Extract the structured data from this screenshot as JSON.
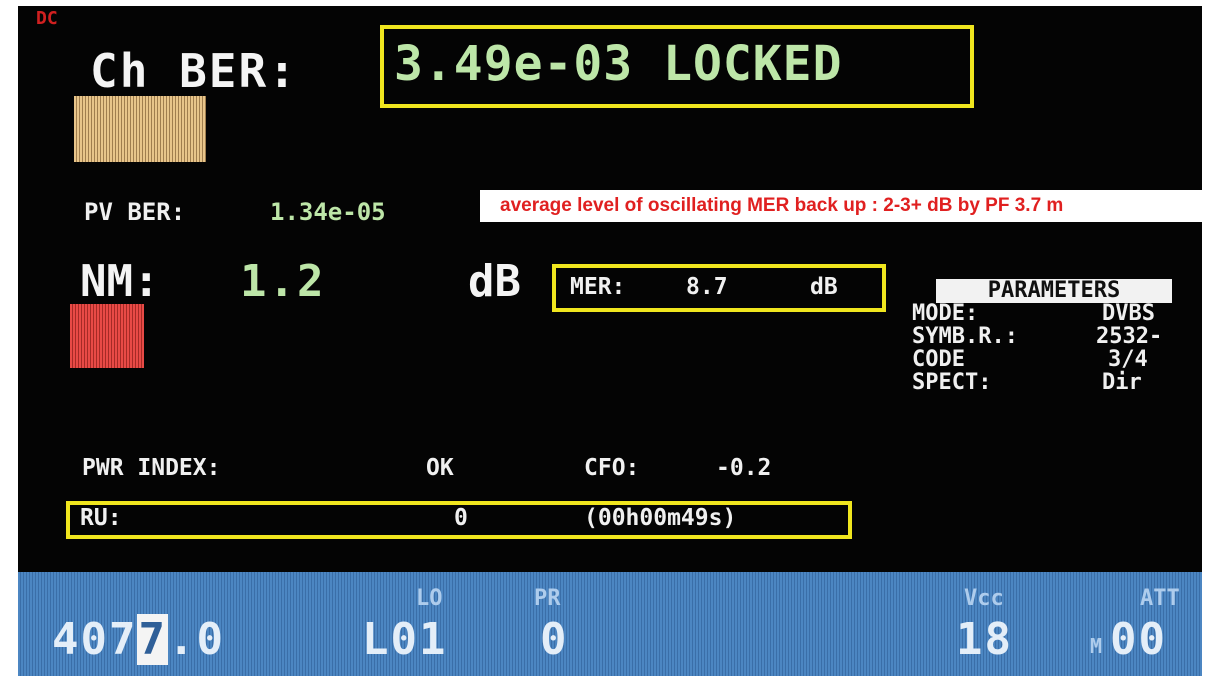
{
  "header": {
    "mode_tag": "DC"
  },
  "ch_ber": {
    "label": "Ch BER:",
    "value": "3.49e-03 LOCKED"
  },
  "pv_ber": {
    "label": "PV BER:",
    "value": "1.34e-05"
  },
  "annotation": {
    "text": "average level of oscillating MER back up : 2-3+ dB by PF 3.7 m"
  },
  "nm": {
    "label": "NM:",
    "value": "1.2",
    "unit": "dB"
  },
  "mer": {
    "label": "MER:",
    "value": "8.7",
    "unit": "dB"
  },
  "parameters": {
    "title": "PARAMETERS",
    "rows": [
      {
        "key": "MODE:",
        "value": "DVBS"
      },
      {
        "key": "SYMB.R.:",
        "value": "2532-"
      },
      {
        "key": "CODE",
        "value": "3/4"
      },
      {
        "key": "SPECT:",
        "value": "Dir"
      }
    ]
  },
  "pwr_index": {
    "label": "PWR INDEX:",
    "value": "OK"
  },
  "cfo": {
    "label": "CFO:",
    "value": "-0.2"
  },
  "ru": {
    "label": "RU:",
    "value": "0",
    "time": "(00h00m49s)"
  },
  "status_bar": {
    "freq_prefix": "407",
    "freq_cursor_digit": "7",
    "freq_suffix": ".0",
    "lo_label": "LO",
    "lo_value": "L01",
    "pr_label": "PR",
    "pr_value": "0",
    "vcc_label": "Vcc",
    "vcc_value": "18",
    "att_label": "ATT",
    "att_mode": "M",
    "att_value": "00"
  },
  "colors": {
    "background": "#040404",
    "value_green": "#bde6a8",
    "highlight_yellow": "#f0e61e",
    "status_blue": "#3a6ea8",
    "ber_bar": "#e8c58a",
    "nm_bar": "#e84a46",
    "annotation_red": "#e02020"
  }
}
